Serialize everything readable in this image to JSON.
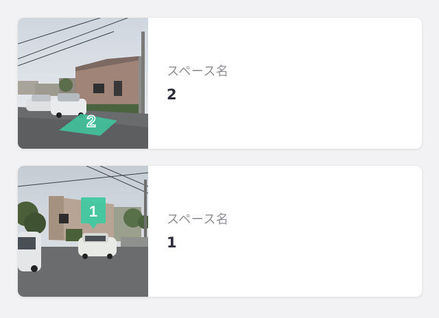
{
  "spaces": [
    {
      "label": "スペース名",
      "name": "2",
      "marker": "2",
      "marker_color": "#3ec9a0"
    },
    {
      "label": "スペース名",
      "name": "1",
      "marker": "1",
      "marker_color": "#3ec9a0"
    }
  ],
  "colors": {
    "background": "#f2f2f4",
    "card": "#ffffff",
    "label": "#8e8e94",
    "name": "#2b2b3a",
    "accent": "#3ec9a0"
  }
}
